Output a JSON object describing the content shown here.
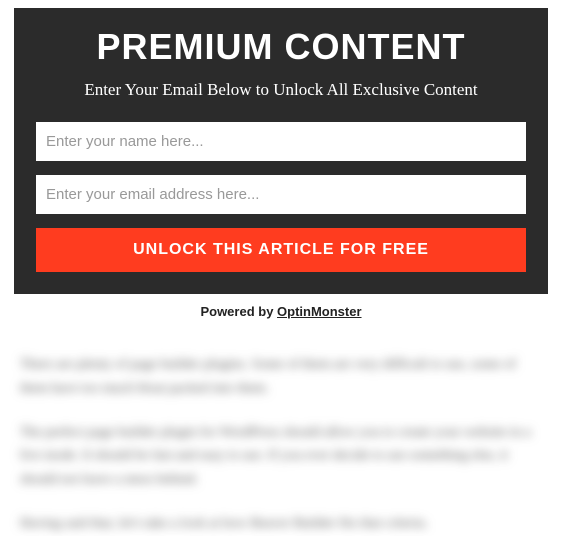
{
  "optin": {
    "title": "PREMIUM CONTENT",
    "subtitle": "Enter Your Email Below to Unlock All Exclusive Content",
    "name_placeholder": "Enter your name here...",
    "email_placeholder": "Enter your email address here...",
    "button_label": "UNLOCK THIS ARTICLE FOR FREE"
  },
  "powered": {
    "prefix": "Powered by ",
    "brand": "OptinMonster"
  },
  "locked_article": {
    "paragraphs": [
      "There are plenty of page builder plugins. Some of them are very difficult to use, some of them have too much bloat packed into them.",
      "The perfect page builder plugin for WordPress should allow you to create your website in a live mode. It should be fast and easy to use. If you ever decide to use something else, it should not leave a mess behind.",
      "Having said that, let's take a look at how Beaver Builder fits that criteria."
    ]
  }
}
